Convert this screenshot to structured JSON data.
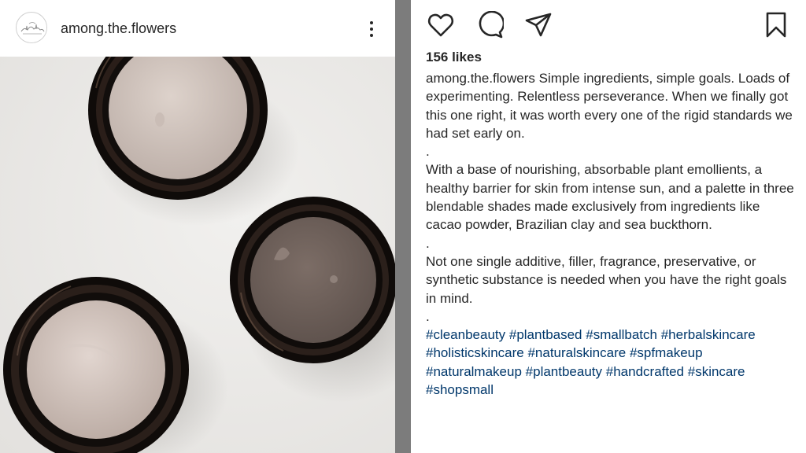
{
  "post": {
    "username": "among.the.flowers",
    "likes": "156 likes"
  },
  "caption": {
    "lead": "Simple ingredients, simple goals. Loads of experimenting. Relentless perseverance. When we finally got this one right, it was worth every one of the rigid standards we had set early on.",
    "sep1": ".",
    "para2": "With a base of nourishing, absorbable plant emollients, a healthy barrier for skin from intense sun, and a palette in three blendable shades made exclusively from ingredients like cacao powder, Brazilian clay and sea buckthorn.",
    "sep2": ".",
    "para3": "Not one single additive, filler, fragrance, preservative, or synthetic substance is needed when you have the right goals in mind.",
    "sep3": "."
  },
  "hashtags": [
    "#cleanbeauty",
    "#plantbased",
    "#smallbatch",
    "#herbalskincare",
    "#holisticskincare",
    "#naturalskincare",
    "#spfmakeup",
    "#naturalmakeup",
    "#plantbeauty",
    "#handcrafted",
    "#skincare",
    "#shopsmall"
  ],
  "icons": {
    "avatar": "avatar-illustration",
    "more": "more-options-icon",
    "like": "heart-icon",
    "comment": "comment-icon",
    "share": "share-icon",
    "save": "bookmark-icon"
  },
  "colors": {
    "text": "#262626",
    "hashtag": "#00376b",
    "divider": "#7c7c7c",
    "photo_background": "#ecebe9"
  }
}
